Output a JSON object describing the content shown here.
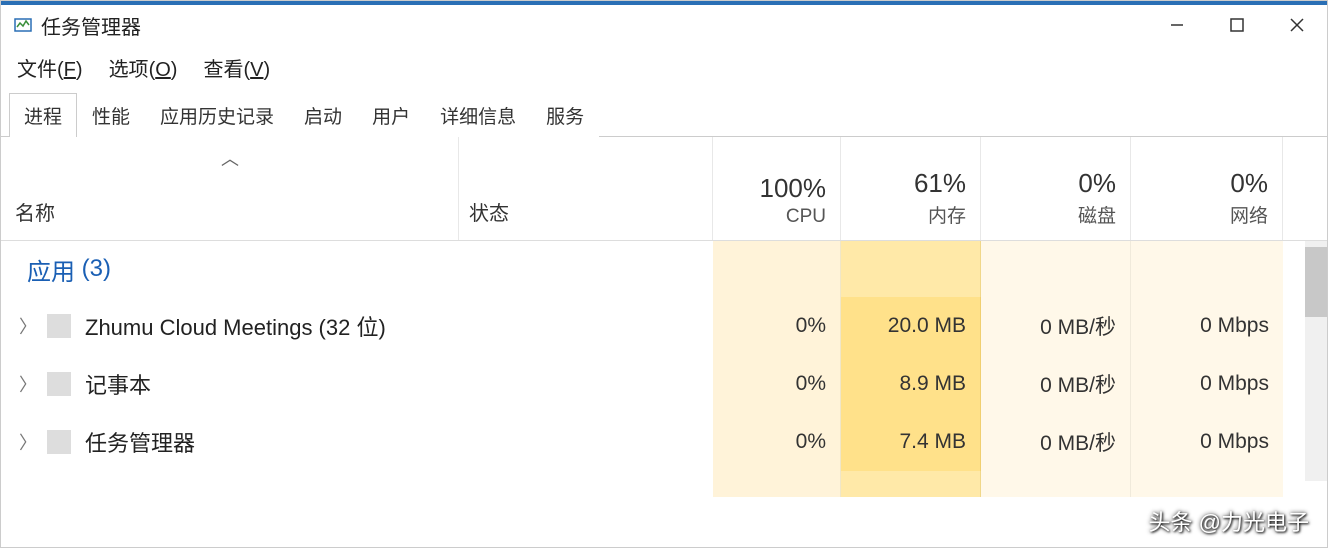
{
  "window": {
    "title": "任务管理器"
  },
  "menubar": {
    "file": {
      "label": "文件",
      "accel": "F"
    },
    "options": {
      "label": "选项",
      "accel": "O"
    },
    "view": {
      "label": "查看",
      "accel": "V"
    }
  },
  "tabs": {
    "processes": "进程",
    "performance": "性能",
    "app_history": "应用历史记录",
    "startup": "启动",
    "users": "用户",
    "details": "详细信息",
    "services": "服务"
  },
  "columns": {
    "name": "名称",
    "status": "状态",
    "cpu": {
      "pct": "100%",
      "label": "CPU"
    },
    "mem": {
      "pct": "61%",
      "label": "内存"
    },
    "disk": {
      "pct": "0%",
      "label": "磁盘"
    },
    "net": {
      "pct": "0%",
      "label": "网络"
    }
  },
  "group": {
    "apps": {
      "name": "应用",
      "count": "(3)"
    }
  },
  "processes": [
    {
      "name": "Zhumu Cloud Meetings (32 位)",
      "cpu": "0%",
      "mem": "20.0 MB",
      "disk": "0 MB/秒",
      "net": "0 Mbps"
    },
    {
      "name": "记事本",
      "cpu": "0%",
      "mem": "8.9 MB",
      "disk": "0 MB/秒",
      "net": "0 Mbps"
    },
    {
      "name": "任务管理器",
      "cpu": "0%",
      "mem": "7.4 MB",
      "disk": "0 MB/秒",
      "net": "0 Mbps"
    }
  ],
  "watermark": "头条 @力光电子"
}
